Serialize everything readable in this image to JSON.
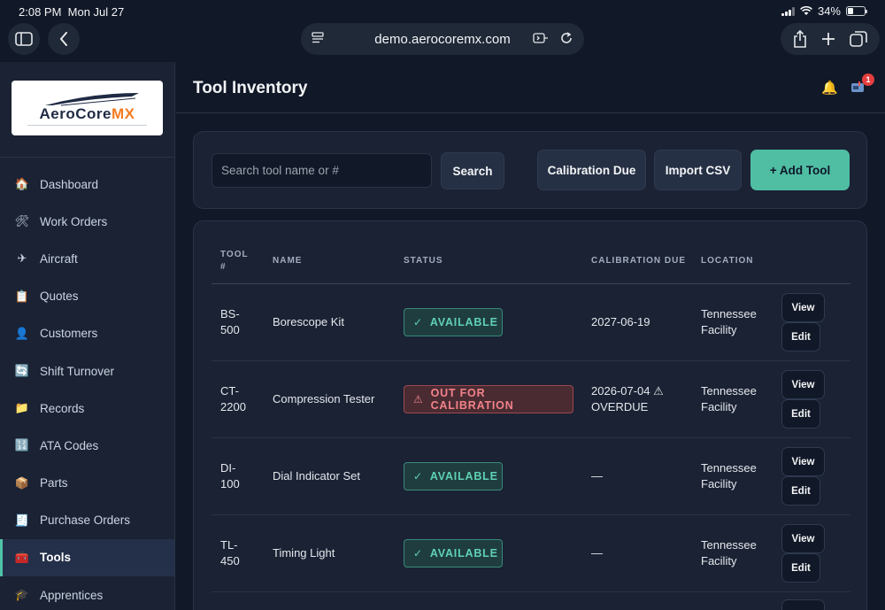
{
  "status_bar": {
    "time": "2:08 PM",
    "date": "Mon Jul 27",
    "battery": "34%",
    "battery_level": 0.34
  },
  "browser": {
    "url": "demo.aerocoremx.com"
  },
  "logo": {
    "brand_main": "AeroCore",
    "brand_accent": "MX"
  },
  "sidebar": {
    "items": [
      {
        "label": "Dashboard",
        "icon": "house-icon",
        "glyph": "🏠",
        "active": false
      },
      {
        "label": "Work Orders",
        "icon": "tools-icon",
        "glyph": "🛠",
        "active": false
      },
      {
        "label": "Aircraft",
        "icon": "airplane-icon",
        "glyph": "✈",
        "active": false
      },
      {
        "label": "Quotes",
        "icon": "clipboard-icon",
        "glyph": "📋",
        "active": false
      },
      {
        "label": "Customers",
        "icon": "user-icon",
        "glyph": "👤",
        "active": false
      },
      {
        "label": "Shift Turnover",
        "icon": "cycle-icon",
        "glyph": "🔄",
        "active": false
      },
      {
        "label": "Records",
        "icon": "folder-icon",
        "glyph": "📁",
        "active": false
      },
      {
        "label": "ATA Codes",
        "icon": "numbers-icon",
        "glyph": "🔢",
        "active": false
      },
      {
        "label": "Parts",
        "icon": "package-icon",
        "glyph": "📦",
        "active": false
      },
      {
        "label": "Purchase Orders",
        "icon": "receipt-icon",
        "glyph": "🧾",
        "active": false
      },
      {
        "label": "Tools",
        "icon": "toolbox-icon",
        "glyph": "🧰",
        "active": true
      },
      {
        "label": "Apprentices",
        "icon": "graduation-cap-icon",
        "glyph": "🎓",
        "active": false
      }
    ]
  },
  "header": {
    "title": "Tool Inventory",
    "notification_count": "1"
  },
  "toolbar": {
    "search_placeholder": "Search tool name or #",
    "search_label": "Search",
    "calibration_label": "Calibration Due",
    "import_label": "Import CSV",
    "add_label": "+ Add Tool"
  },
  "table": {
    "columns": {
      "tool": "TOOL #",
      "name": "NAME",
      "status": "STATUS",
      "calibration": "CALIBRATION DUE",
      "location": "LOCATION"
    },
    "view_label": "View",
    "edit_label": "Edit",
    "rows": [
      {
        "tool_no": "BS-500",
        "name": "Borescope Kit",
        "status": "AVAILABLE",
        "status_type": "ok",
        "calibration": "2027-06-19",
        "location": "Tennessee Facility"
      },
      {
        "tool_no": "CT-2200",
        "name": "Compression Tester",
        "status": "OUT FOR CALIBRATION",
        "status_type": "bad",
        "calibration": "2026-07-04 ⚠ OVERDUE",
        "location": "Tennessee Facility"
      },
      {
        "tool_no": "DI-100",
        "name": "Dial Indicator Set",
        "status": "AVAILABLE",
        "status_type": "ok",
        "calibration": "—",
        "location": "Tennessee Facility"
      },
      {
        "tool_no": "TL-450",
        "name": "Timing Light",
        "status": "AVAILABLE",
        "status_type": "ok",
        "calibration": "—",
        "location": "Tennessee Facility"
      }
    ]
  },
  "colors": {
    "accent": "#4fbea3",
    "danger": "#f2828a",
    "background": "#111827",
    "panel": "#1a2234"
  }
}
